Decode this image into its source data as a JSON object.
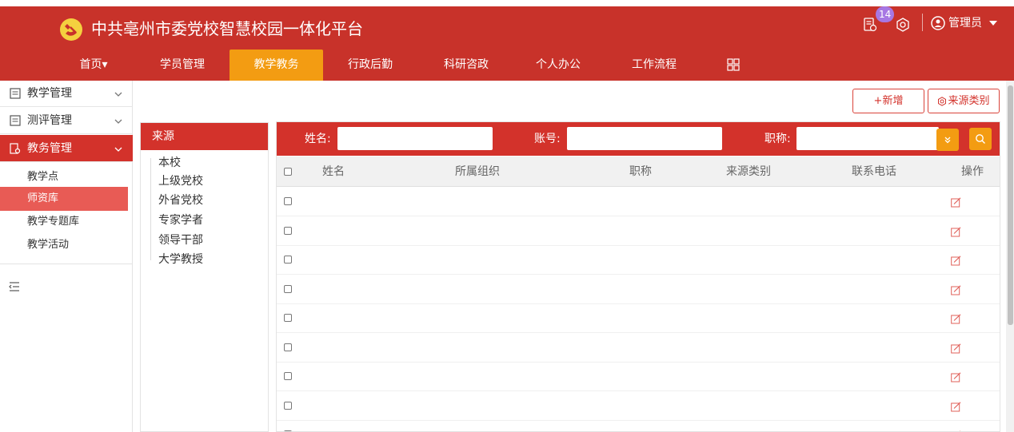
{
  "header": {
    "title": "中共亳州市委党校智慧校园一体化平台",
    "notification_count": "14",
    "user_label": "管理员",
    "icons": [
      "party-emblem-icon",
      "notice-icon",
      "settings-icon",
      "user-circle-icon",
      "caret-down-icon"
    ]
  },
  "nav": {
    "items": [
      {
        "label": "首页▾"
      },
      {
        "label": "学员管理"
      },
      {
        "label": "教学教务"
      },
      {
        "label": "行政后勤"
      },
      {
        "label": "科研咨政"
      },
      {
        "label": "个人办公"
      },
      {
        "label": "工作流程"
      }
    ],
    "active": "教学教务",
    "grid_icon": "grid-icon"
  },
  "sidebar": {
    "groups": [
      {
        "label": "教学管理"
      },
      {
        "label": "测评管理"
      },
      {
        "label": "教务管理"
      }
    ],
    "sub_items": [
      {
        "label": "教学点"
      },
      {
        "label": "师资库"
      },
      {
        "label": "教学专题库"
      },
      {
        "label": "教学活动"
      }
    ],
    "active_group": "教务管理",
    "active_sub": "师资库"
  },
  "toolbar": {
    "add_label": "+新增",
    "source_type_label": "来源类别"
  },
  "tree": {
    "title": "来源",
    "items": [
      {
        "label": "本校"
      },
      {
        "label": "上级党校"
      },
      {
        "label": "外省党校"
      },
      {
        "label": "专家学者"
      },
      {
        "label": "领导干部"
      },
      {
        "label": "大学教授"
      }
    ]
  },
  "filters": {
    "name_label": "姓名:",
    "account_label": "账号:",
    "title_label": "职称:",
    "name_value": "",
    "account_value": "",
    "title_value": ""
  },
  "table": {
    "columns": [
      "姓名",
      "所属组织",
      "职称",
      "来源类别",
      "联系电话",
      "操作"
    ],
    "row_count": 9
  },
  "colors": {
    "primary_red": "#c8322a",
    "active_orange": "#f39c12",
    "sidebar_active": "#d3322b",
    "sub_active": "#e85b55",
    "badge_purple": "#a777e3"
  }
}
